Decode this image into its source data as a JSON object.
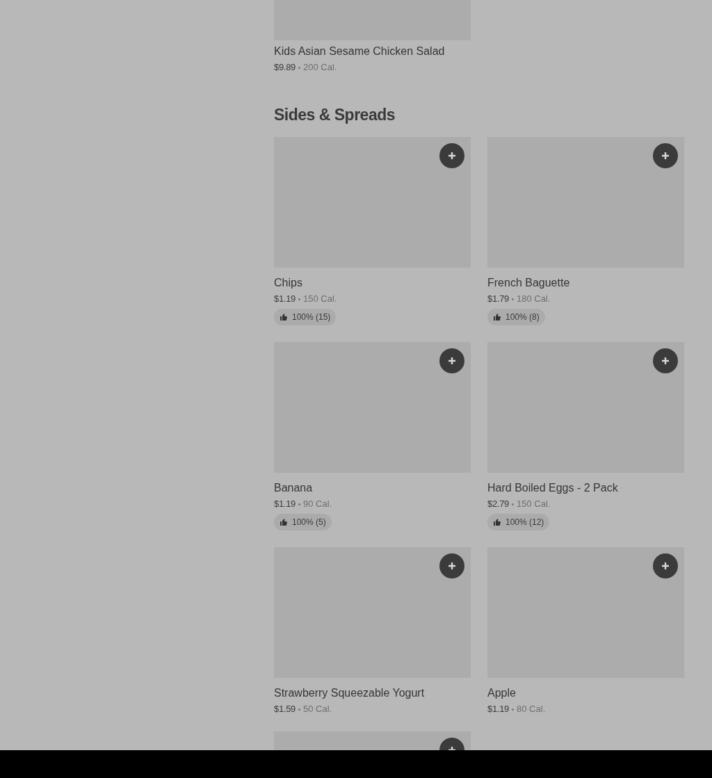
{
  "top_item": {
    "name": "Kids Asian Sesame Chicken Salad",
    "price": "$9.89",
    "calories": "200 Cal."
  },
  "section": {
    "title": "Sides & Spreads",
    "items": [
      {
        "name": "Chips",
        "price": "$1.19",
        "calories": "150 Cal.",
        "rating": "100% (15)"
      },
      {
        "name": "French Baguette",
        "price": "$1.79",
        "calories": "180 Cal.",
        "rating": "100% (8)"
      },
      {
        "name": "Banana",
        "price": "$1.19",
        "calories": "90 Cal.",
        "rating": "100% (5)"
      },
      {
        "name": "Hard Boiled Eggs - 2 Pack",
        "price": "$2.79",
        "calories": "150 Cal.",
        "rating": "100% (12)"
      },
      {
        "name": "Strawberry Squeezable Yogurt",
        "price": "$1.59",
        "calories": "50 Cal."
      },
      {
        "name": "Apple",
        "price": "$1.19",
        "calories": "80 Cal."
      }
    ],
    "partial_items": [
      {
        "kind": "image-only"
      }
    ]
  }
}
